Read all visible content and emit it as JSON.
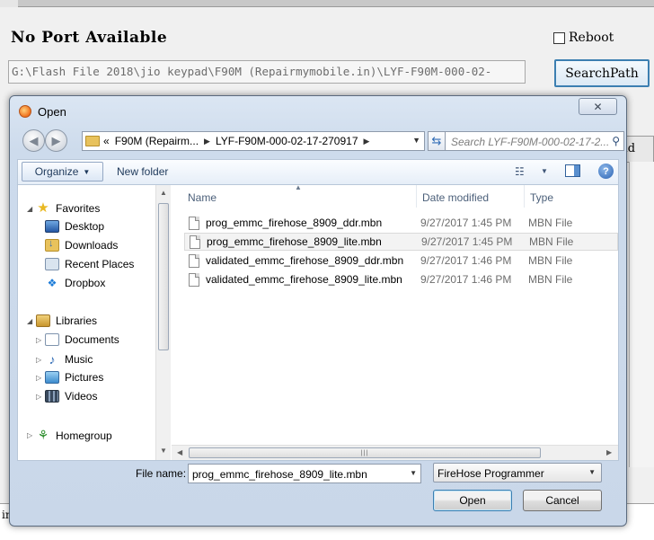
{
  "app": {
    "port_status": "No Port Available",
    "reboot_label": "Reboot",
    "reboot_checked": false,
    "path_value": "G:\\Flash File 2018\\jio keypad\\F90M (Repairmymobile.in)\\LYF-F90M-000-02-",
    "search_path_label": "SearchPath",
    "partial_button_label": "ad",
    "log_prefix": "in"
  },
  "dialog": {
    "title": "Open",
    "close_glyph": "✕",
    "address": {
      "crumbs": [
        "F90M (Repairm...",
        "LYF-F90M-000-02-17-270917"
      ],
      "prefix": "«"
    },
    "search_placeholder": "Search LYF-F90M-000-02-17-2...",
    "toolbar": {
      "organize": "Organize",
      "new_folder": "New folder"
    },
    "nav": {
      "favorites": "Favorites",
      "desktop": "Desktop",
      "downloads": "Downloads",
      "recent_places": "Recent Places",
      "dropbox": "Dropbox",
      "libraries": "Libraries",
      "documents": "Documents",
      "music": "Music",
      "pictures": "Pictures",
      "videos": "Videos",
      "homegroup": "Homegroup"
    },
    "columns": {
      "name": "Name",
      "date_modified": "Date modified",
      "type": "Type"
    },
    "files": [
      {
        "name": "prog_emmc_firehose_8909_ddr.mbn",
        "date": "9/27/2017 1:45 PM",
        "type": "MBN File"
      },
      {
        "name": "prog_emmc_firehose_8909_lite.mbn",
        "date": "9/27/2017 1:45 PM",
        "type": "MBN File"
      },
      {
        "name": "validated_emmc_firehose_8909_ddr.mbn",
        "date": "9/27/2017 1:46 PM",
        "type": "MBN File"
      },
      {
        "name": "validated_emmc_firehose_8909_lite.mbn",
        "date": "9/27/2017 1:46 PM",
        "type": "MBN File"
      }
    ],
    "selected_file_index": 1,
    "file_name_label": "File name:",
    "file_name_value": "prog_emmc_firehose_8909_lite.mbn",
    "file_type_filter": "FireHose Programmer",
    "open_label": "Open",
    "cancel_label": "Cancel"
  }
}
